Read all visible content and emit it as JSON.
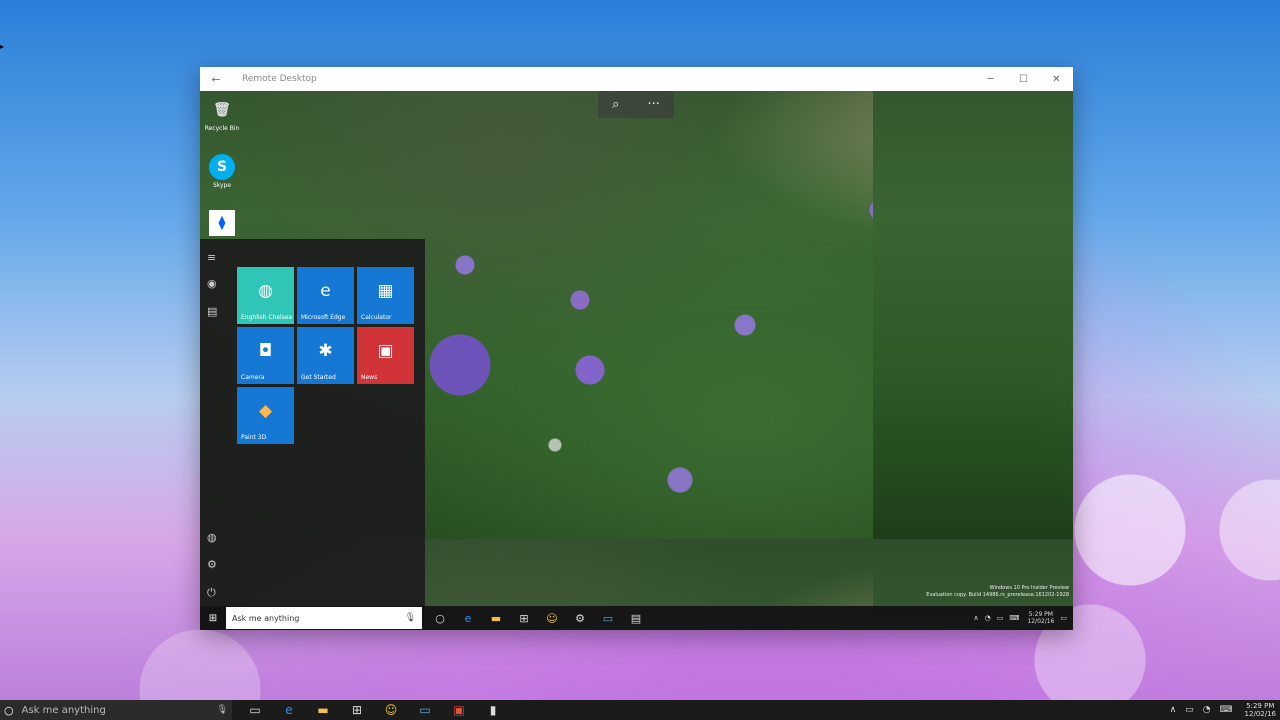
{
  "window": {
    "title": "Remote Desktop",
    "back_icon": "back-arrow-icon",
    "controls": [
      "─",
      "☐",
      "✕"
    ]
  },
  "remote_toolbar": {
    "zoom_icon": "zoom-icon",
    "more_icon": "more-icon"
  },
  "desktop_icons": [
    {
      "label": "Recycle Bin",
      "icon": "recycle-bin-icon",
      "glyph": "🗑"
    },
    {
      "label": "Skype",
      "icon": "skype-icon",
      "glyph": "S"
    },
    {
      "label": "",
      "icon": "dropbox-icon",
      "glyph": "⧫"
    }
  ],
  "start_menu": {
    "rail": [
      "≡",
      "◉",
      "▤",
      "◍",
      "⚙",
      "⏻"
    ],
    "tiles": [
      {
        "label": "Enghlish Chelsea",
        "icon": "globe-tile-icon",
        "glyph": "◍",
        "color": "#2fc6b7"
      },
      {
        "label": "Microsoft Edge",
        "icon": "edge-icon",
        "glyph": "e",
        "color": "#1478d4"
      },
      {
        "label": "Calculator",
        "icon": "calculator-icon",
        "glyph": "▦",
        "color": "#1478d4"
      },
      {
        "label": "Camera",
        "icon": "camera-icon",
        "glyph": "◘",
        "color": "#1478d4"
      },
      {
        "label": "Get Started",
        "icon": "lightbulb-icon",
        "glyph": "✱",
        "color": "#1478d4"
      },
      {
        "label": "News",
        "icon": "news-icon",
        "glyph": "▣",
        "color": "#d13438"
      },
      {
        "label": "Paint 3D",
        "icon": "paint3d-icon",
        "glyph": "◆",
        "color": "#1478d4"
      }
    ]
  },
  "remote_taskbar": {
    "search_placeholder": "Ask me anything",
    "apps": [
      "○",
      "e",
      "▬",
      "⊞",
      "☺",
      "⚙",
      "▭",
      "▤"
    ],
    "tray": [
      "∧",
      "◔",
      "▭",
      "⌨"
    ],
    "time": "5:29 PM",
    "date": "12/02/16"
  },
  "watermark": {
    "line1": "Windows 10 Pro Insider Preview",
    "line2": "Evaluation copy. Build 14986.rs_prerelease.161202-1928"
  },
  "host_taskbar": {
    "search_placeholder": "Ask me anything",
    "apps": [
      "▭",
      "e",
      "▬",
      "⊞",
      "☺",
      "▭",
      "▣",
      "▮"
    ],
    "tray": [
      "∧",
      "▭",
      "◔",
      "⌨"
    ],
    "time": "5:29 PM",
    "date": "12/02/16"
  }
}
